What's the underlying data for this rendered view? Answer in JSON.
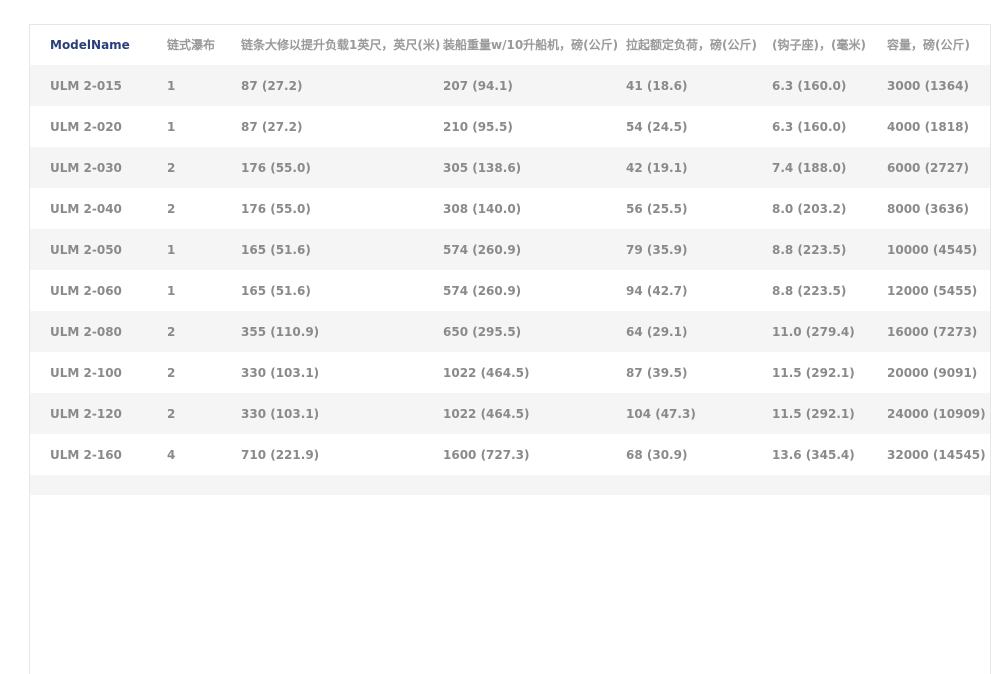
{
  "table": {
    "headers": [
      "ModelName",
      "链式瀑布",
      "链条大修以提升负载1英尺，英尺(米)",
      "装船重量w/10升船机，磅(公斤)",
      "拉起额定负荷，磅(公斤)",
      "(钩子座)，(毫米)",
      "容量，磅(公斤)"
    ],
    "rows": [
      [
        "ULM 2-015",
        "1",
        "87 (27.2)",
        "207 (94.1)",
        "41 (18.6)",
        "6.3 (160.0)",
        "3000 (1364)"
      ],
      [
        "ULM 2-020",
        "1",
        "87 (27.2)",
        "210 (95.5)",
        "54 (24.5)",
        "6.3 (160.0)",
        "4000 (1818)"
      ],
      [
        "ULM 2-030",
        "2",
        "176 (55.0)",
        "305 (138.6)",
        "42 (19.1)",
        "7.4 (188.0)",
        "6000 (2727)"
      ],
      [
        "ULM 2-040",
        "2",
        "176 (55.0)",
        "308 (140.0)",
        "56 (25.5)",
        "8.0 (203.2)",
        "8000 (3636)"
      ],
      [
        "ULM 2-050",
        "1",
        "165 (51.6)",
        "574 (260.9)",
        "79 (35.9)",
        "8.8 (223.5)",
        "10000 (4545)"
      ],
      [
        "ULM 2-060",
        "1",
        "165 (51.6)",
        "574 (260.9)",
        "94 (42.7)",
        "8.8 (223.5)",
        "12000 (5455)"
      ],
      [
        "ULM 2-080",
        "2",
        "355 (110.9)",
        "650 (295.5)",
        "64 (29.1)",
        "11.0 (279.4)",
        "16000 (7273)"
      ],
      [
        "ULM 2-100",
        "2",
        "330 (103.1)",
        "1022 (464.5)",
        "87 (39.5)",
        "11.5 (292.1)",
        "20000 (9091)"
      ],
      [
        "ULM 2-120",
        "2",
        "330 (103.1)",
        "1022 (464.5)",
        "104 (47.3)",
        "11.5 (292.1)",
        "24000 (10909)"
      ],
      [
        "ULM 2-160",
        "4",
        "710 (221.9)",
        "1600 (727.3)",
        "68 (30.9)",
        "13.6 (345.4)",
        "32000 (14545)"
      ],
      [
        "",
        "",
        "",
        "",
        "",
        "",
        ""
      ]
    ]
  }
}
